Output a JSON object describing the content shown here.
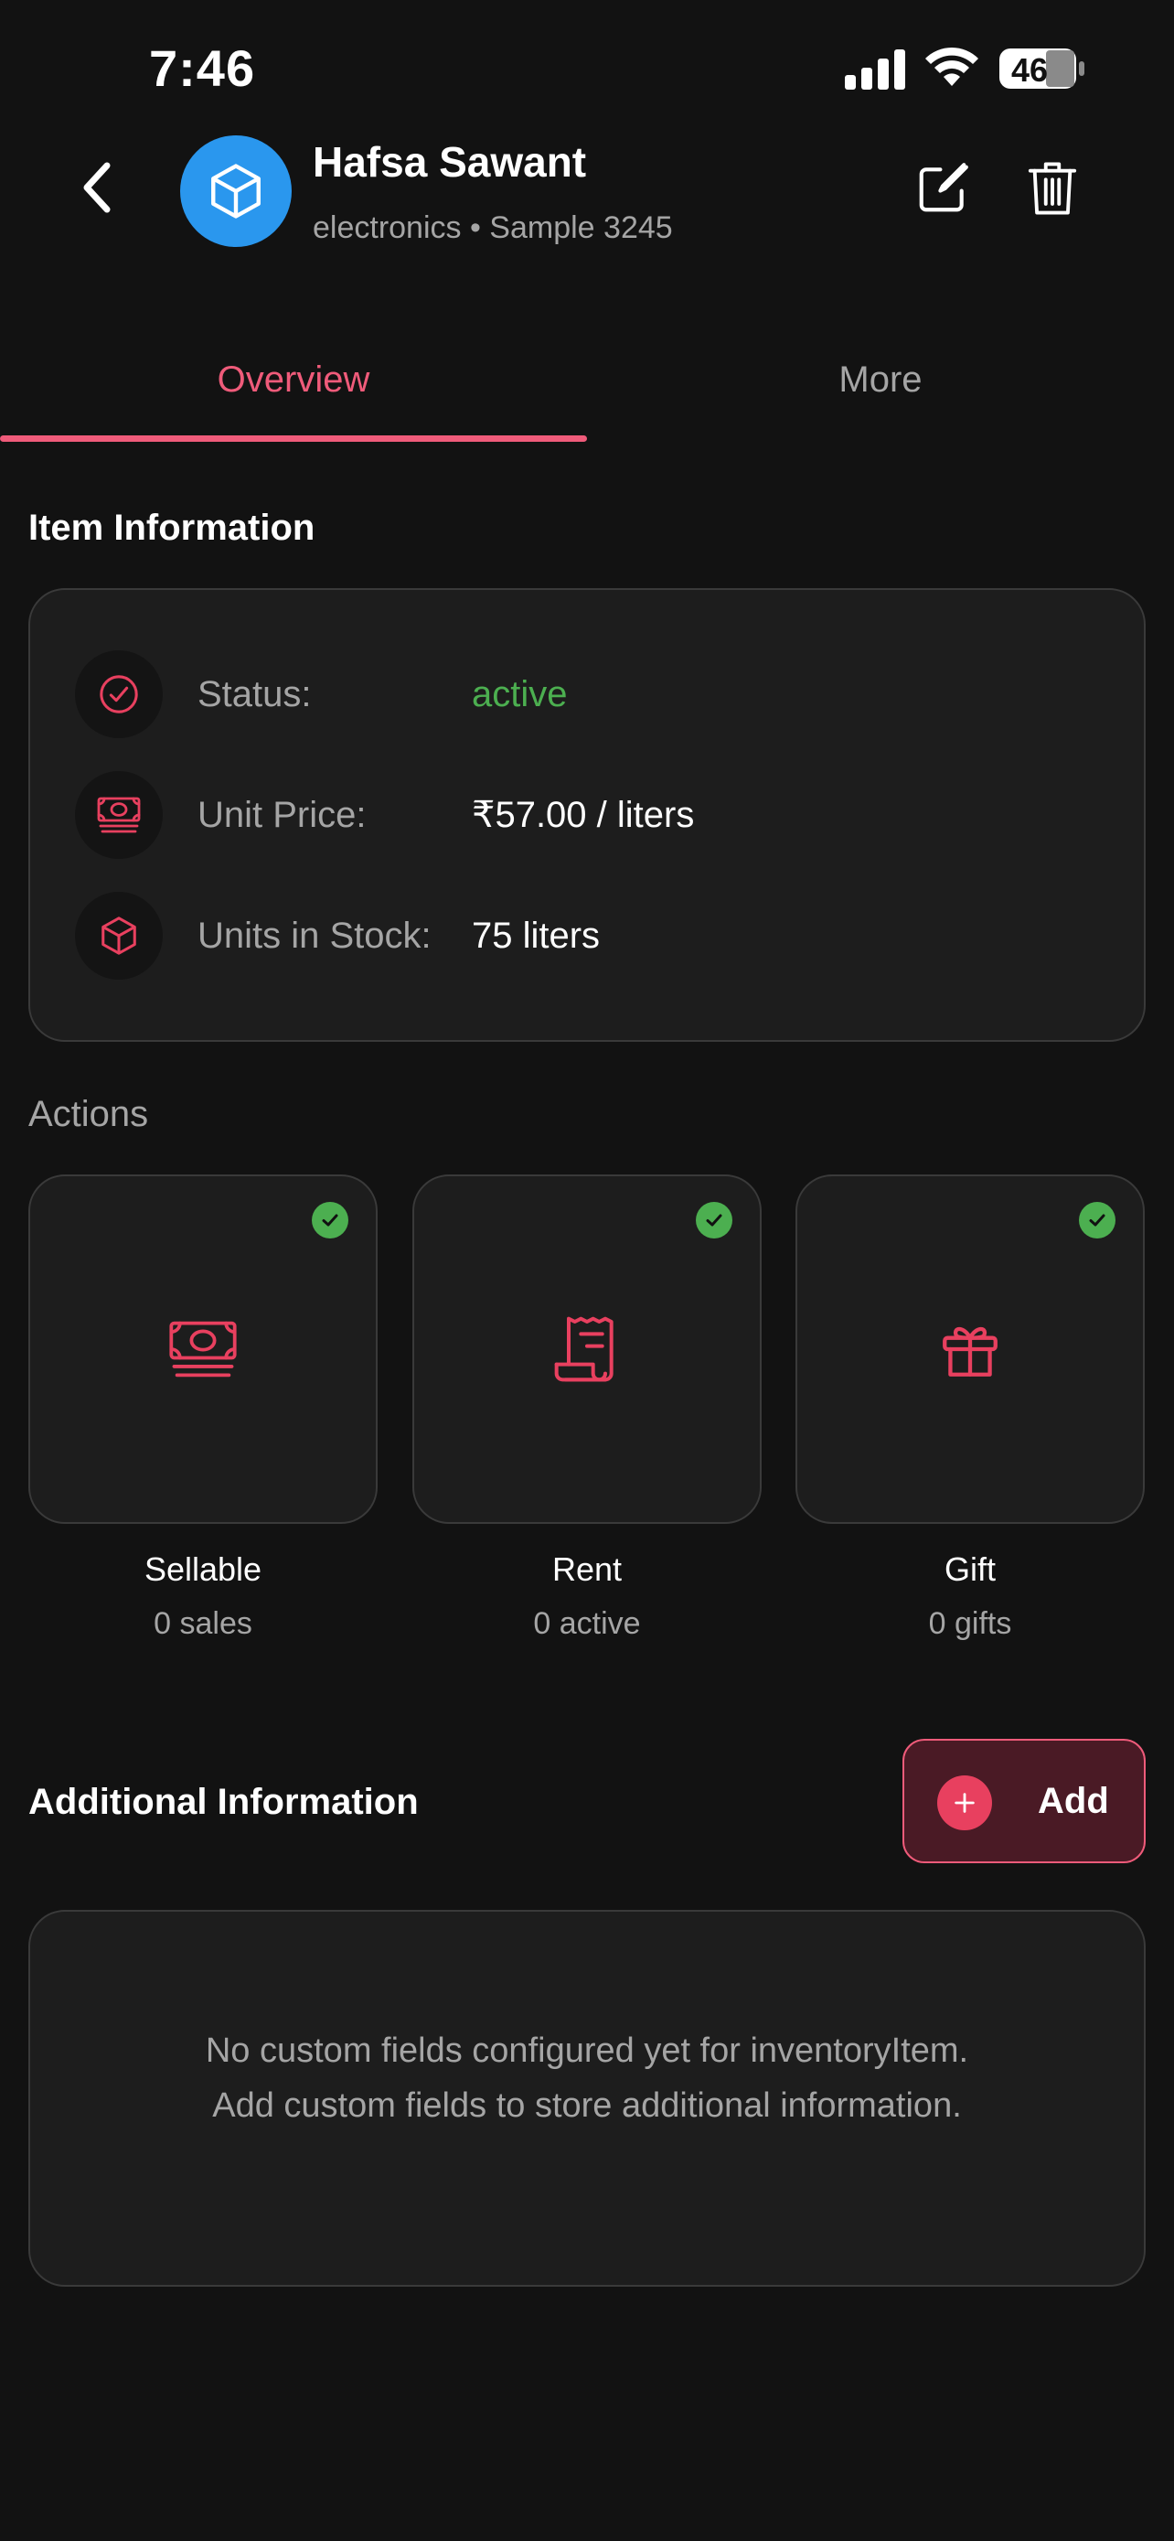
{
  "status_bar": {
    "time": "7:46",
    "battery": "46"
  },
  "header": {
    "name": "Hafsa Sawant",
    "subtitle": "electronics • Sample 3245",
    "avatar_icon": "cube-icon",
    "avatar_color": "#2a97ee"
  },
  "tabs": [
    {
      "label": "Overview",
      "active": true
    },
    {
      "label": "More",
      "active": false
    }
  ],
  "item_info": {
    "title": "Item Information",
    "rows": [
      {
        "label": "Status:",
        "value": "active",
        "icon": "check-circle-icon"
      },
      {
        "label": "Unit Price:",
        "value": "₹57.00 / liters",
        "icon": "banknote-icon"
      },
      {
        "label": "Units in Stock:",
        "value": "75 liters",
        "icon": "cube-icon"
      }
    ]
  },
  "actions": {
    "title": "Actions",
    "items": [
      {
        "name": "Sellable",
        "count": "0 sales",
        "icon": "banknote-icon",
        "enabled": true
      },
      {
        "name": "Rent",
        "count": "0 active",
        "icon": "receipt-icon",
        "enabled": true
      },
      {
        "name": "Gift",
        "count": "0 gifts",
        "icon": "gift-icon",
        "enabled": true
      }
    ]
  },
  "additional_info": {
    "title": "Additional Information",
    "add_label": "Add",
    "empty_line1": "No custom fields configured yet for inventoryItem.",
    "empty_line2": "Add custom fields to store additional information."
  },
  "colors": {
    "accent": "#ef5b7a",
    "success": "#4caf50",
    "background": "#121212",
    "card": "#1d1d1d"
  }
}
